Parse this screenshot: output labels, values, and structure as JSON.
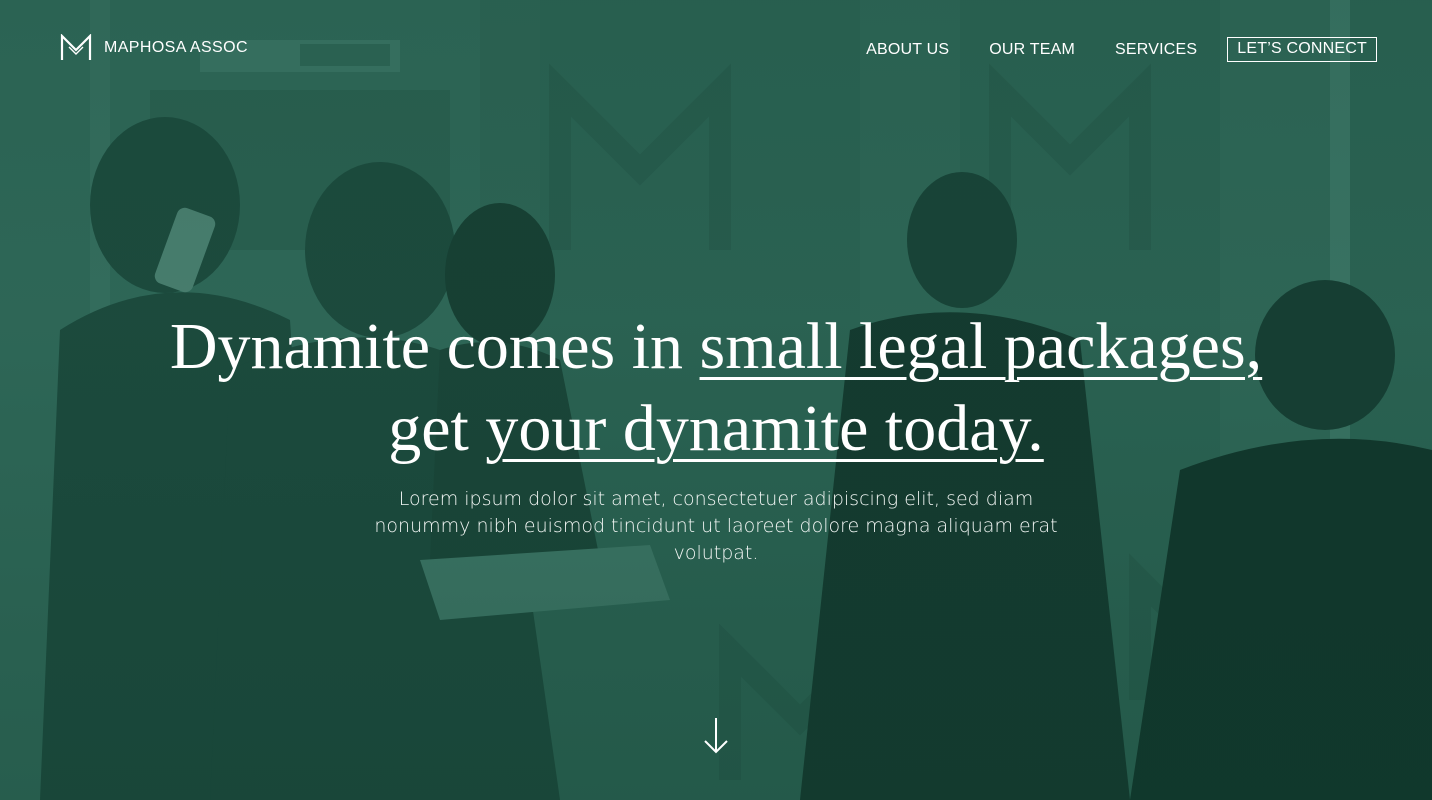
{
  "brand": {
    "name": "MAPHOSA ASSOC",
    "icon": "m-monogram-icon"
  },
  "nav": {
    "items": [
      {
        "label": "ABOUT US"
      },
      {
        "label": "OUR TEAM"
      },
      {
        "label": "SERVICES"
      }
    ],
    "cta": "LET’S CONNECT"
  },
  "hero": {
    "headline_line1_plain": "Dynamite comes in ",
    "headline_line1_underlined": "small legal packages,",
    "headline_line2_plain": "get ",
    "headline_line2_underlined": "your dynamite today.",
    "subtext": "Lorem ipsum dolor sit amet, consectetuer adipiscing elit, sed diam nonummy nibh euismod tincidunt ut laoreet dolore magna aliquam erat volutpat.",
    "scroll_icon": "arrow-down-icon"
  },
  "colors": {
    "duotone_green": "#23584a",
    "text": "#ffffff"
  }
}
